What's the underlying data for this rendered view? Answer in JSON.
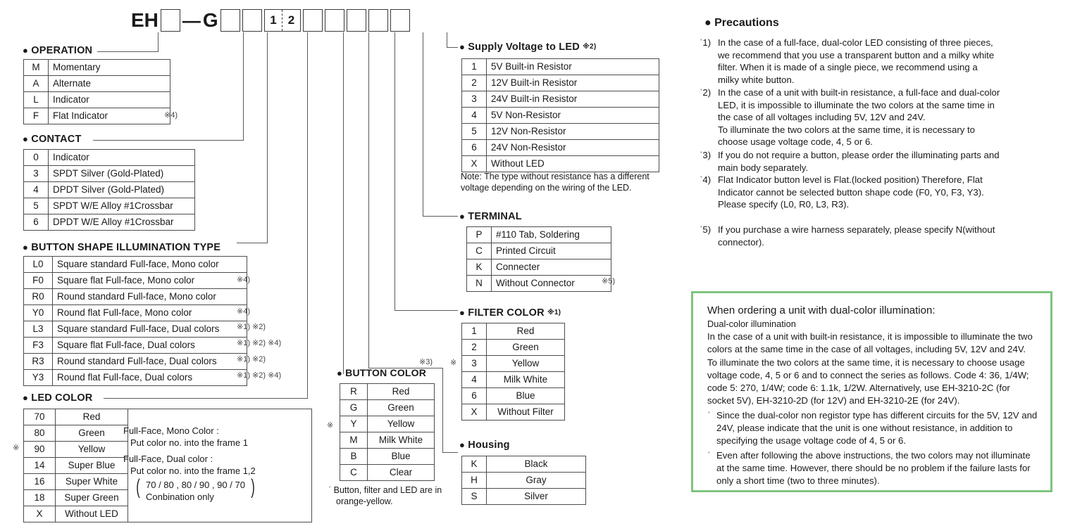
{
  "code_row": {
    "prefix": "EH",
    "dash": "—",
    "g": "G",
    "frame1": "1",
    "frame2": "2"
  },
  "sections": {
    "operation": {
      "bullet": "●",
      "title": "OPERATION",
      "rows": [
        {
          "code": "M",
          "label": "Momentary",
          "mark": ""
        },
        {
          "code": "A",
          "label": "Alternate",
          "mark": ""
        },
        {
          "code": "L",
          "label": "Indicator",
          "mark": ""
        },
        {
          "code": "F",
          "label": "Flat Indicator",
          "mark": "※4)"
        }
      ]
    },
    "contact": {
      "bullet": "●",
      "title": "CONTACT",
      "rows": [
        {
          "code": "0",
          "label": "Indicator"
        },
        {
          "code": "3",
          "label": "SPDT Silver (Gold-Plated)"
        },
        {
          "code": "4",
          "label": "DPDT Silver (Gold-Plated)"
        },
        {
          "code": "5",
          "label": "SPDT W/E Alloy #1Crossbar"
        },
        {
          "code": "6",
          "label": "DPDT W/E Alloy #1Crossbar"
        }
      ]
    },
    "button_shape": {
      "bullet": "●",
      "title": "BUTTON SHAPE ILLUMINATION TYPE",
      "rows": [
        {
          "code": "L0",
          "label": "Square standard   Full-face, Mono color",
          "mark": ""
        },
        {
          "code": "F0",
          "label": "Square flat  Full-face, Mono color",
          "mark": "※4)"
        },
        {
          "code": "R0",
          "label": "Round standard  Full-face, Mono color",
          "mark": ""
        },
        {
          "code": "Y0",
          "label": "Round flat  Full-face, Mono color",
          "mark": "※4)"
        },
        {
          "code": "L3",
          "label": "Square standard  Full-face, Dual colors",
          "mark": "※1)  ※2)"
        },
        {
          "code": "F3",
          "label": "Square flat  Full-face, Dual colors",
          "mark": "※1)  ※2)  ※4)"
        },
        {
          "code": "R3",
          "label": "Round standard  Full-face, Dual colors",
          "mark": "※1)  ※2)"
        },
        {
          "code": "Y3",
          "label": "Round flat  Full-face, Dual colors",
          "mark": "※1)  ※2)  ※4)"
        }
      ]
    },
    "led_color": {
      "bullet": "●",
      "title": "LED COLOR",
      "side_mark": "※",
      "rows": [
        {
          "code": "70",
          "label": "Red"
        },
        {
          "code": "80",
          "label": "Green"
        },
        {
          "code": "90",
          "label": "Yellow"
        },
        {
          "code": "14",
          "label": "Super Blue"
        },
        {
          "code": "16",
          "label": "Super White"
        },
        {
          "code": "18",
          "label": "Super Green"
        },
        {
          "code": "X",
          "label": "Without LED"
        }
      ],
      "explanation": {
        "mono_l1": "Full-Face, Mono Color :",
        "mono_l2": "Put color no. into the frame 1",
        "dual_l1": "Full-Face, Dual color :",
        "dual_l2": "Put color no. into the frame 1,2",
        "combo_l1": "70 / 80 , 80 / 90 , 90 / 70",
        "combo_l2": "Conbination only"
      }
    },
    "button_color": {
      "bullet": "●",
      "title": "BUTTON COLOR",
      "head_mark": "※3)",
      "side_mark": "※",
      "rows": [
        {
          "code": "R",
          "label": "Red"
        },
        {
          "code": "G",
          "label": "Green"
        },
        {
          "code": "Y",
          "label": "Yellow"
        },
        {
          "code": "M",
          "label": "Milk White"
        },
        {
          "code": "B",
          "label": "Blue"
        },
        {
          "code": "C",
          "label": "Clear"
        }
      ],
      "footnote_l1": "ˈ Button, filter and LED are in",
      "footnote_l2": "orange-yellow."
    },
    "supply_voltage": {
      "bullet": "●",
      "title": "Supply Voltage to LED",
      "head_mark": "※2)",
      "rows": [
        {
          "code": "1",
          "label": "5V Built-in Resistor"
        },
        {
          "code": "2",
          "label": "12V Built-in Resistor"
        },
        {
          "code": "3",
          "label": "24V Built-in Resistor"
        },
        {
          "code": "4",
          "label": "5V Non-Resistor"
        },
        {
          "code": "5",
          "label": "12V Non-Resistor"
        },
        {
          "code": "6",
          "label": "24V Non-Resistor"
        },
        {
          "code": "X",
          "label": "Without LED"
        }
      ],
      "note_l1": "Note: The type without resistance has a different",
      "note_l2": "voltage depending on the wiring of the LED."
    },
    "terminal": {
      "bullet": "●",
      "title": "TERMINAL",
      "rows": [
        {
          "code": "P",
          "label": "#110 Tab, Soldering",
          "mark": ""
        },
        {
          "code": "C",
          "label": "Printed Circuit",
          "mark": ""
        },
        {
          "code": "K",
          "label": "Connecter",
          "mark": ""
        },
        {
          "code": "N",
          "label": "Without Connector",
          "mark": "※5)"
        }
      ]
    },
    "filter_color": {
      "bullet": "●",
      "title": "FILTER COLOR",
      "head_mark": "※1)",
      "side_mark": "※",
      "rows": [
        {
          "code": "1",
          "label": "Red"
        },
        {
          "code": "2",
          "label": "Green"
        },
        {
          "code": "3",
          "label": "Yellow"
        },
        {
          "code": "4",
          "label": "Milk White"
        },
        {
          "code": "6",
          "label": "Blue"
        },
        {
          "code": "X",
          "label": "Without Filter"
        }
      ]
    },
    "housing": {
      "bullet": "●",
      "title": "Housing",
      "rows": [
        {
          "code": "K",
          "label": "Black"
        },
        {
          "code": "H",
          "label": "Gray"
        },
        {
          "code": "S",
          "label": "Silver"
        }
      ]
    }
  },
  "precautions": {
    "bullet": "●",
    "title": "Precautions",
    "items": [
      {
        "label": "ˈ1)",
        "lines": [
          "In the case of a full-face, dual-color LED consisting of three pieces,",
          "we recommend that you use a transparent button and a milky white",
          "filter. When it is made of a single piece, we recommend using a",
          "milky white button."
        ]
      },
      {
        "label": "ˈ2)",
        "lines": [
          "In the case of a unit with built-in resistance, a full-face and dual-color",
          "LED, it is impossible to illuminate the two colors at the same time in",
          "the case of all voltages including 5V, 12V and 24V.",
          "To illuminate the two colors at the same time, it is necessary to",
          "choose usage voltage code, 4, 5 or 6."
        ]
      },
      {
        "label": "ˈ3)",
        "lines": [
          "If you do not require a button, please order the illuminating parts and",
          "main body separately."
        ]
      },
      {
        "label": "ˈ4)",
        "lines": [
          "Flat Indicator button level is Flat.(locked position) Therefore, Flat",
          "Indicator cannot be selected button shape code (F0, Y0, F3, Y3).",
          "Please specify (L0, R0, L3, R3)."
        ]
      },
      {
        "label": "ˈ5)",
        "lines": [
          "If you purchase a wire harness separately, please specify N(without",
          "connector)."
        ]
      }
    ]
  },
  "ordering_box": {
    "border_color": "#7fc47f",
    "title": "When ordering a unit with dual-color illumination:",
    "subtitle": "Dual-color illumination",
    "paragraph": [
      "In the case of a unit with built-in resistance, it is impossible to illuminate the two",
      "colors at the same time in the case of all voltages, including 5V, 12V and 24V.",
      "To illuminate the two colors at the same time, it is necessary to choose usage",
      "voltage code, 4, 5 or 6 and to connect the series as follows. Code 4: 36, 1/4W;",
      "code 5: 270, 1/4W; code 6: 1.1k, 1/2W. Alternatively, use EH-3210-2C (for",
      "socket 5V), EH-3210-2D (for 12V) and EH-3210-2E (for 24V)."
    ],
    "stars": [
      {
        "marker": "ˈ",
        "lines": [
          "Since the dual-color non registor type has different circuits for the 5V, 12V and",
          "24V, please indicate that the unit is one without resistance, in addition to",
          "specifying the usage voltage code of 4, 5 or 6."
        ]
      },
      {
        "marker": "ˈ",
        "lines": [
          "Even after following the above instructions, the two colors may not illuminate",
          "at the same time. However, there should be no problem if the failure lasts for",
          "only a short time (two to three minutes)."
        ]
      }
    ]
  }
}
